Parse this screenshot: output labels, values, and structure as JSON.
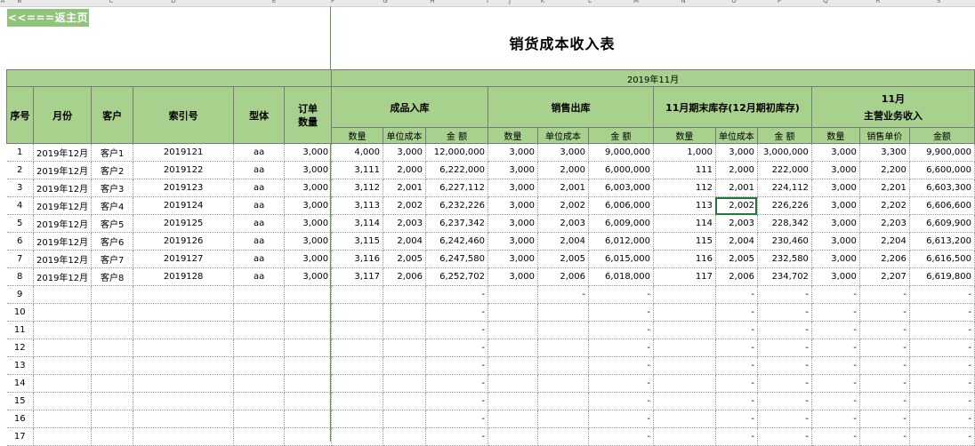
{
  "nav": {
    "back_label": "<<===返主页"
  },
  "page_title": "销货成本收入表",
  "col_letters": [
    "A",
    "B",
    "C",
    "D",
    "E",
    "F",
    "G",
    "H",
    "I",
    "J",
    "K",
    "L",
    "M",
    "N",
    "O",
    "P",
    "Q",
    "R",
    "S"
  ],
  "header": {
    "period": "2019年11月",
    "seq": "序号",
    "month": "月份",
    "customer": "客户",
    "index_no": "索引号",
    "model": "型体",
    "order_qty": "订单\n数量",
    "group_in": "成品入库",
    "group_out": "销售出库",
    "group_stock": "11月期末库存(12月期初库存)",
    "group_income_line1": "11月",
    "group_income_line2": "主营业务收入",
    "qty": "数量",
    "unit_cost": "单位成本",
    "amount": "金 额",
    "amount_income": "金额",
    "unit_price": "销售单价"
  },
  "rows": [
    {
      "seq": "1",
      "month": "2019年12月",
      "customer": "客户1",
      "index": "2019121",
      "model": "aa",
      "order_qty": "3,000",
      "in_qty": "4,000",
      "in_cost": "3,000",
      "in_amt": "12,000,000",
      "out_qty": "3,000",
      "out_cost": "3,000",
      "out_amt": "9,000,000",
      "st_qty": "1,000",
      "st_cost": "3,000",
      "st_amt": "3,000,000",
      "inc_qty": "3,000",
      "inc_price": "3,300",
      "inc_amt": "9,900,000"
    },
    {
      "seq": "2",
      "month": "2019年12月",
      "customer": "客户2",
      "index": "2019122",
      "model": "aa",
      "order_qty": "3,000",
      "in_qty": "3,111",
      "in_cost": "2,000",
      "in_amt": "6,222,000",
      "out_qty": "3,000",
      "out_cost": "2,000",
      "out_amt": "6,000,000",
      "st_qty": "111",
      "st_cost": "2,000",
      "st_amt": "222,000",
      "inc_qty": "3,000",
      "inc_price": "2,200",
      "inc_amt": "6,600,000"
    },
    {
      "seq": "3",
      "month": "2019年12月",
      "customer": "客户3",
      "index": "2019123",
      "model": "aa",
      "order_qty": "3,000",
      "in_qty": "3,112",
      "in_cost": "2,001",
      "in_amt": "6,227,112",
      "out_qty": "3,000",
      "out_cost": "2,001",
      "out_amt": "6,003,000",
      "st_qty": "112",
      "st_cost": "2,001",
      "st_amt": "224,112",
      "inc_qty": "3,000",
      "inc_price": "2,201",
      "inc_amt": "6,603,300"
    },
    {
      "seq": "4",
      "month": "2019年12月",
      "customer": "客户4",
      "index": "2019124",
      "model": "aa",
      "order_qty": "3,000",
      "in_qty": "3,113",
      "in_cost": "2,002",
      "in_amt": "6,232,226",
      "out_qty": "3,000",
      "out_cost": "2,002",
      "out_amt": "6,006,000",
      "st_qty": "113",
      "st_cost": "2,002",
      "st_amt": "226,226",
      "inc_qty": "3,000",
      "inc_price": "2,202",
      "inc_amt": "6,606,600"
    },
    {
      "seq": "5",
      "month": "2019年12月",
      "customer": "客户5",
      "index": "2019125",
      "model": "aa",
      "order_qty": "3,000",
      "in_qty": "3,114",
      "in_cost": "2,003",
      "in_amt": "6,237,342",
      "out_qty": "3,000",
      "out_cost": "2,003",
      "out_amt": "6,009,000",
      "st_qty": "114",
      "st_cost": "2,003",
      "st_amt": "228,342",
      "inc_qty": "3,000",
      "inc_price": "2,203",
      "inc_amt": "6,609,900"
    },
    {
      "seq": "6",
      "month": "2019年12月",
      "customer": "客户6",
      "index": "2019126",
      "model": "aa",
      "order_qty": "3,000",
      "in_qty": "3,115",
      "in_cost": "2,004",
      "in_amt": "6,242,460",
      "out_qty": "3,000",
      "out_cost": "2,004",
      "out_amt": "6,012,000",
      "st_qty": "115",
      "st_cost": "2,004",
      "st_amt": "230,460",
      "inc_qty": "3,000",
      "inc_price": "2,204",
      "inc_amt": "6,613,200"
    },
    {
      "seq": "7",
      "month": "2019年12月",
      "customer": "客户7",
      "index": "2019127",
      "model": "aa",
      "order_qty": "3,000",
      "in_qty": "3,116",
      "in_cost": "2,005",
      "in_amt": "6,247,580",
      "out_qty": "3,000",
      "out_cost": "2,005",
      "out_amt": "6,015,000",
      "st_qty": "116",
      "st_cost": "2,005",
      "st_amt": "232,580",
      "inc_qty": "3,000",
      "inc_price": "2,206",
      "inc_amt": "6,616,500"
    },
    {
      "seq": "8",
      "month": "2019年12月",
      "customer": "客户8",
      "index": "2019128",
      "model": "aa",
      "order_qty": "3,000",
      "in_qty": "3,117",
      "in_cost": "2,006",
      "in_amt": "6,252,702",
      "out_qty": "3,000",
      "out_cost": "2,006",
      "out_amt": "6,018,000",
      "st_qty": "117",
      "st_cost": "2,006",
      "st_amt": "234,702",
      "inc_qty": "3,000",
      "inc_price": "2,207",
      "inc_amt": "6,619,800"
    },
    {
      "seq": "9",
      "in_amt": "-",
      "out_cost": "-",
      "out_amt": "-",
      "st_cost": "-",
      "st_amt": "-",
      "inc_qty": "-",
      "inc_price": "-",
      "inc_amt": "-"
    },
    {
      "seq": "10",
      "in_amt": "-",
      "out_amt": "-",
      "st_cost": "-",
      "st_amt": "-",
      "inc_qty": "-",
      "inc_price": "-",
      "inc_amt": "-"
    },
    {
      "seq": "11",
      "in_amt": "-",
      "out_amt": "-",
      "st_cost": "-",
      "st_amt": "-",
      "inc_qty": "-",
      "inc_price": "-",
      "inc_amt": "-"
    },
    {
      "seq": "12",
      "in_amt": "-",
      "out_amt": "-",
      "st_cost": "-",
      "st_amt": "-",
      "inc_qty": "-",
      "inc_price": "-",
      "inc_amt": "-"
    },
    {
      "seq": "13",
      "in_amt": "-",
      "out_amt": "-",
      "st_cost": "-",
      "st_amt": "-",
      "inc_qty": "-",
      "inc_price": "-",
      "inc_amt": "-"
    },
    {
      "seq": "14",
      "in_amt": "-",
      "out_amt": "-",
      "st_cost": "-",
      "st_amt": "-",
      "inc_qty": "-",
      "inc_price": "-",
      "inc_amt": "-"
    },
    {
      "seq": "15",
      "in_amt": "-",
      "out_amt": "-",
      "st_cost": "-",
      "st_amt": "-",
      "inc_qty": "-",
      "inc_price": "-",
      "inc_amt": "-"
    },
    {
      "seq": "16",
      "in_amt": "-",
      "out_amt": "-",
      "st_cost": "-",
      "st_amt": "-",
      "inc_qty": "-",
      "inc_price": "-",
      "inc_amt": "-"
    },
    {
      "seq": "17",
      "in_amt": "-",
      "out_amt": "-",
      "st_cost": "-",
      "st_amt": "-",
      "inc_qty": "-",
      "inc_price": "-",
      "inc_amt": "-"
    }
  ],
  "selected_cell": {
    "row": 3,
    "col": "st_cost"
  },
  "colors": {
    "header_green": "#a9d18e",
    "button_green": "#8fc47a",
    "frozen_line": "#5aa048"
  }
}
